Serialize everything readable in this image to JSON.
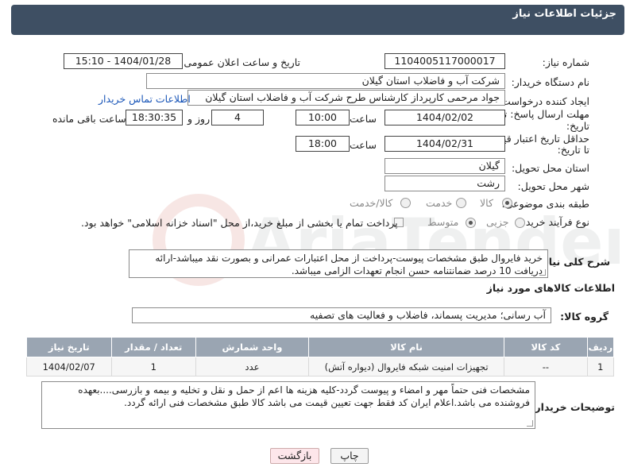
{
  "header": {
    "title": "جزئیات اطلاعات نیاز"
  },
  "fields": {
    "need_number_label": "شماره نیاز:",
    "need_number": "1104005117000017",
    "announce_label": "تاریخ و ساعت اعلان عمومی:",
    "announce_value": "1404/01/28 - 15:10",
    "buyer_org_label": "نام دستگاه خریدار:",
    "buyer_org": "شرکت آب و فاضلاب استان گیلان",
    "requester_label": "ایجاد کننده درخواست:",
    "requester": "جواد مرحمی کارپرداز کارشناس طرح شرکت آب و فاضلاب استان گیلان",
    "contact_link": "اطلاعات تماس خریدار",
    "deadline_label_1": "مهلت ارسال پاسخ: تا",
    "deadline_label_2": "تاریخ:",
    "deadline_date": "1404/02/02",
    "time_label": "ساعت",
    "deadline_time": "10:00",
    "days_value": "4",
    "days_label": "روز و",
    "remaining_time": "18:30:35",
    "remaining_label": "ساعت باقی مانده",
    "validity_label_1": "حداقل تاریخ اعتبار قیمت:",
    "validity_label_2": "تا تاریخ:",
    "validity_date": "1404/02/31",
    "validity_time": "18:00",
    "province_label": "استان محل تحویل:",
    "province": "گیلان",
    "city_label": "شهر محل تحویل:",
    "city": "رشت",
    "category_label": "طبقه بندی موضوعی:",
    "category_options": [
      "کالا",
      "خدمت",
      "کالا/خدمت"
    ],
    "process_label": "نوع فرآیند خرید :",
    "process_options": [
      "جزیی",
      "متوسط"
    ],
    "payment_note": "پرداخت تمام یا بخشی از مبلغ خرید،از محل \"اسناد خزانه اسلامی\" خواهد بود.",
    "summary_label": "شرح کلی نیاز:",
    "summary": "خرید فایروال طبق مشخصات پیوست-پرداخت از محل اعتبارات عمرانی و بصورت نقد میباشد-ارائه دریافت 10 درصد ضمانتنامه حسن انجام تعهدات الزامی میباشد.",
    "goods_info_title": "اطلاعات کالاهای مورد نیاز",
    "goods_group_label": "گروه کالا:",
    "goods_group": "آب رسانی؛ مدیریت پسماند، فاضلاب و فعالیت های تصفیه"
  },
  "table": {
    "headers": [
      "ردیف",
      "کد کالا",
      "نام کالا",
      "واحد شمارش",
      "تعداد / مقدار",
      "تاریخ نیاز"
    ],
    "rows": [
      [
        "1",
        "--",
        "تجهیزات امنیت شبکه فایروال (دیواره آتش)",
        "عدد",
        "1",
        "1404/02/07"
      ]
    ]
  },
  "buyer_notes_label": "توضیحات خریدار:",
  "buyer_notes": "مشخصات فنی حتماً مهر و امضاء و پیوست گردد-کلیه هزینه ها اعم از حمل و نقل و تخلیه و بیمه و بازرسی....بعهده فروشنده می باشد.اعلام ایران کد فقط جهت تعیین قیمت می باشد کالا طبق مشخصات فنی ارائه گردد.",
  "buttons": {
    "print": "چاپ",
    "back": "بازگشت"
  },
  "watermark": "AriaTender.neT",
  "colors": {
    "header_bg": "#3e4f63",
    "table_header_bg": "#9aa5b2",
    "link": "#1a56b8",
    "back_button_bg": "#fde6ea"
  }
}
